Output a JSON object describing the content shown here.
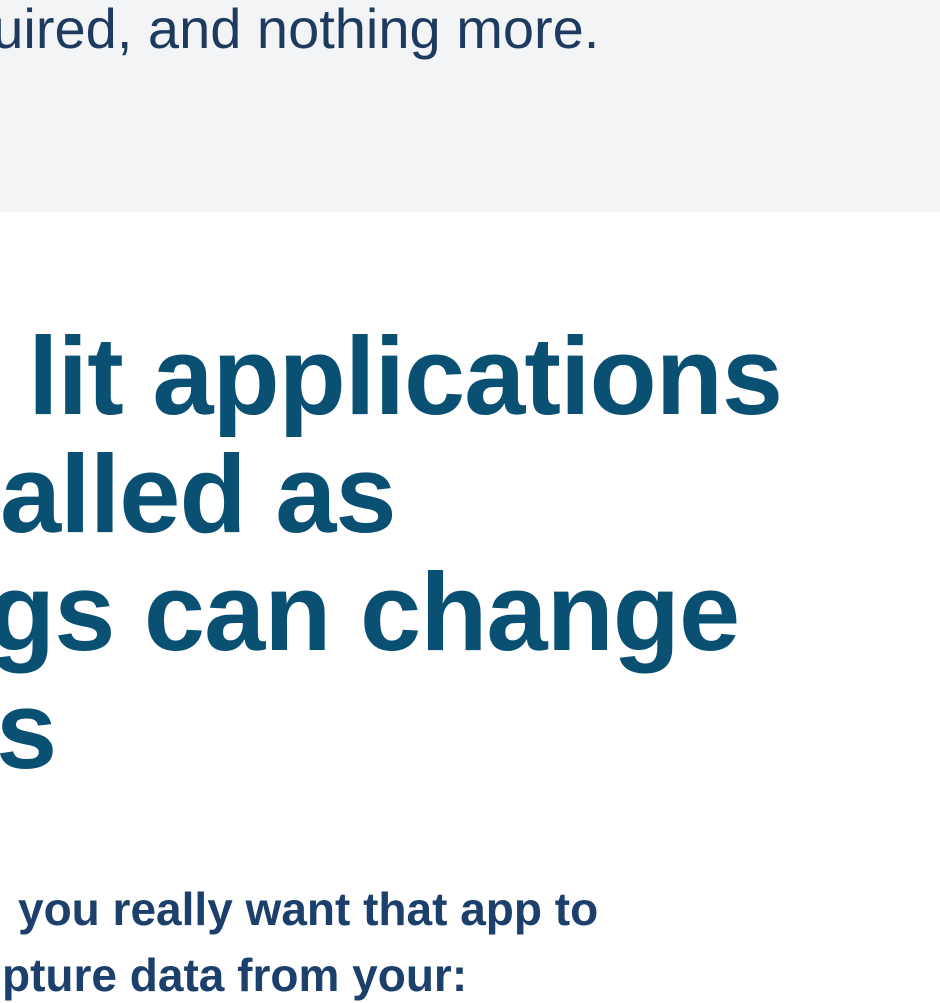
{
  "intro": {
    "text": "equired, and nothing more."
  },
  "heading": {
    "lines": [
      "lit applications",
      "alled as",
      "gs can change",
      "s"
    ]
  },
  "subheading": {
    "lines": [
      "you really want that app to",
      "pture data from your:"
    ]
  },
  "colors": {
    "band_background": "#f3f4f6",
    "heading": "#0a5073",
    "body_text": "#1f3a5f"
  }
}
